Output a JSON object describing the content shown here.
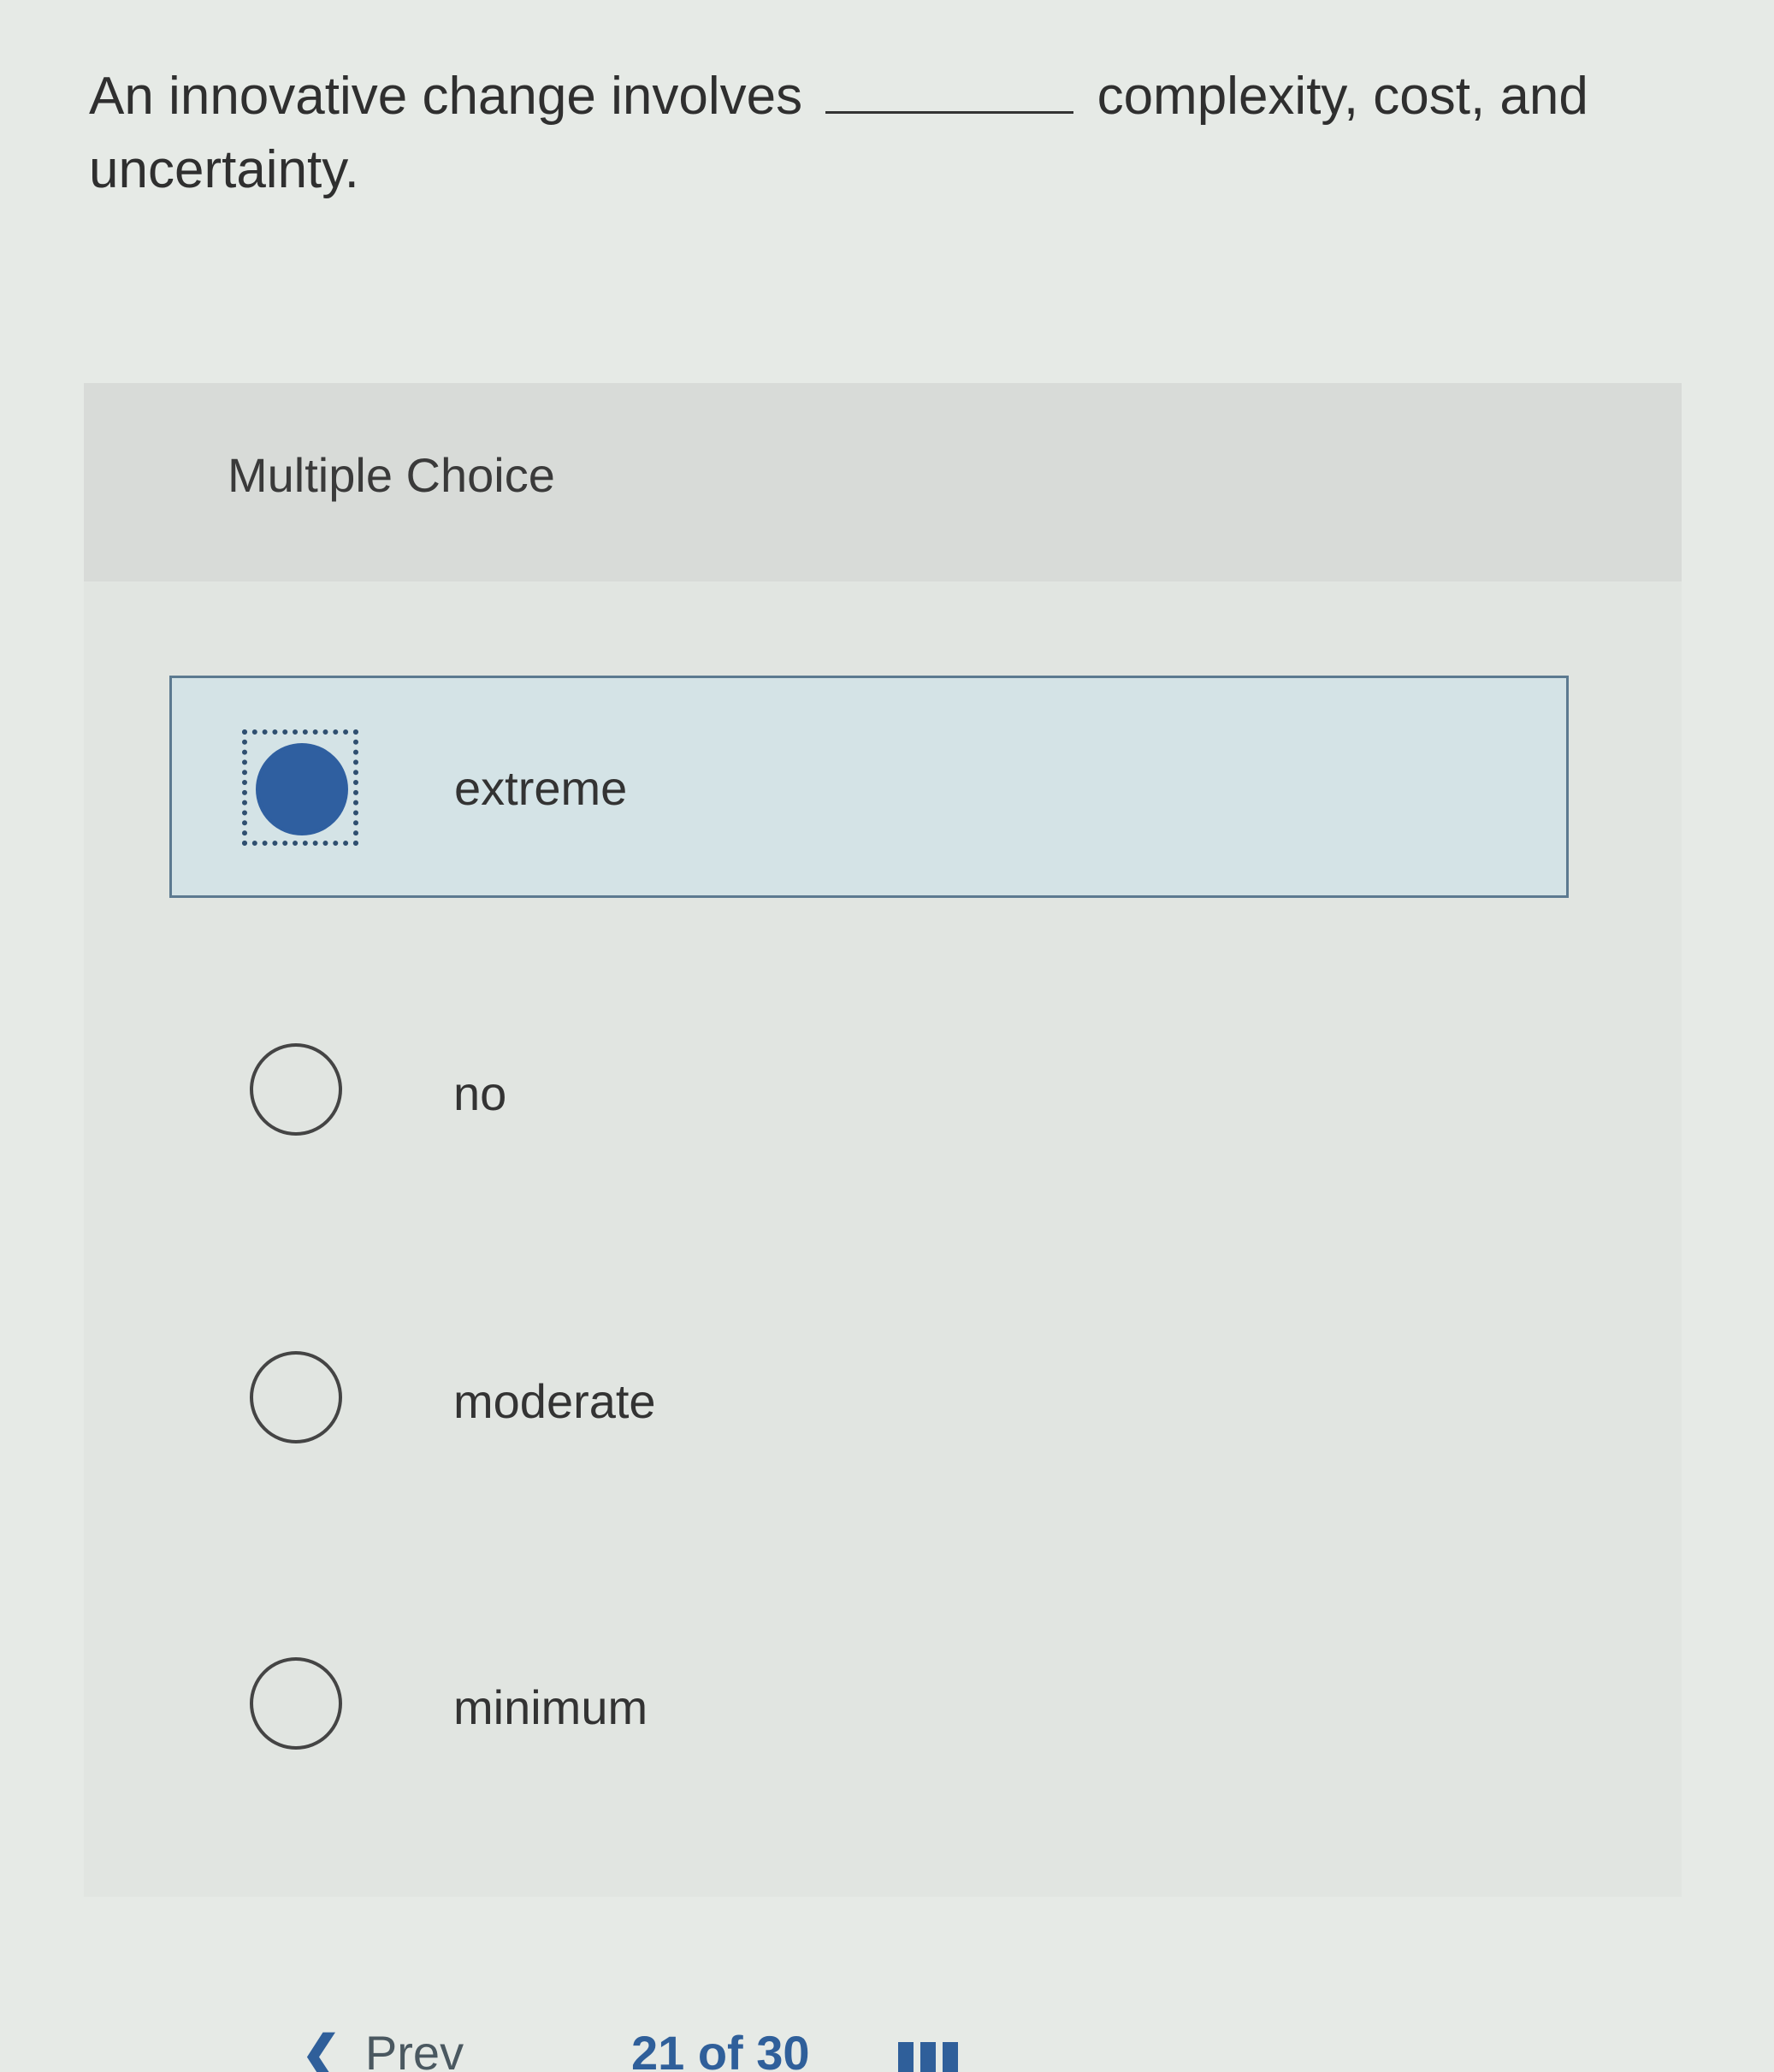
{
  "question": {
    "text_before": "An innovative change involves",
    "text_after": "complexity, cost, and uncertainty."
  },
  "multiple_choice": {
    "title": "Multiple Choice",
    "options": [
      {
        "label": "extreme",
        "selected": true
      },
      {
        "label": "no",
        "selected": false
      },
      {
        "label": "moderate",
        "selected": false
      },
      {
        "label": "minimum",
        "selected": false
      }
    ]
  },
  "nav": {
    "prev_label": "Prev",
    "page_indicator": "21 of 30"
  },
  "colors": {
    "accent": "#2f5fa0",
    "selected_bg": "#d4e3e6"
  },
  "icons": {
    "prev": "chevron-left-icon",
    "question_grid": "grid-icon"
  }
}
